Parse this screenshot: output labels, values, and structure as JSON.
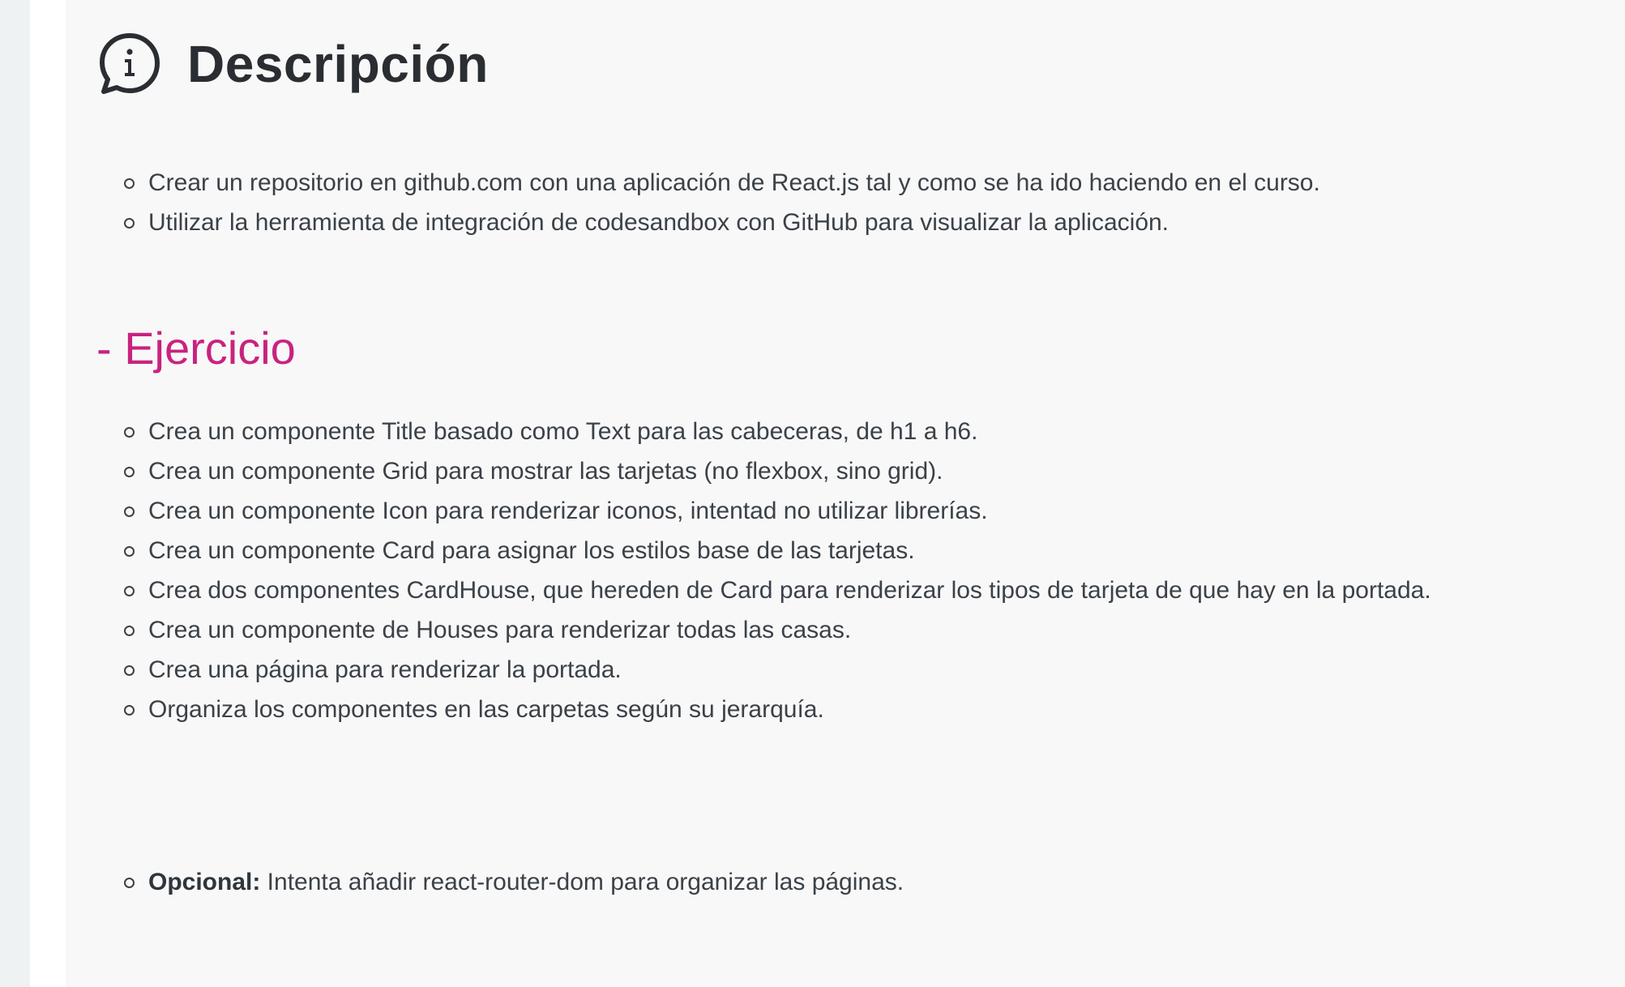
{
  "header": {
    "title": "Descripción",
    "icon": "info-chat-icon"
  },
  "description": {
    "items": [
      "Crear un repositorio en github.com con una aplicación de React.js tal y como se ha ido haciendo en el curso.",
      "Utilizar la herramienta de integración de codesandbox con GitHub para visualizar la aplicación."
    ]
  },
  "exercise": {
    "title": "- Ejercicio",
    "items": [
      "Crea un componente Title basado como Text para las cabeceras, de h1 a h6.",
      "Crea un componente Grid para mostrar las tarjetas (no flexbox, sino grid).",
      "Crea un componente Icon para renderizar iconos, intentad no utilizar librerías.",
      "Crea un componente Card para asignar los estilos base de las tarjetas.",
      "Crea dos componentes CardHouse, que hereden de Card para renderizar los tipos de tarjeta de que hay en la portada.",
      "Crea un componente de Houses para renderizar todas las casas.",
      "Crea una página para renderizar la portada.",
      "Organiza los componentes en las carpetas según su jerarquía."
    ]
  },
  "optional": {
    "label": "Opcional:",
    "text": " Intenta añadir react-router-dom para organizar las páginas."
  },
  "colors": {
    "accent": "#c8237f",
    "text": "#3b4148",
    "panel": "#f8f8f8"
  }
}
